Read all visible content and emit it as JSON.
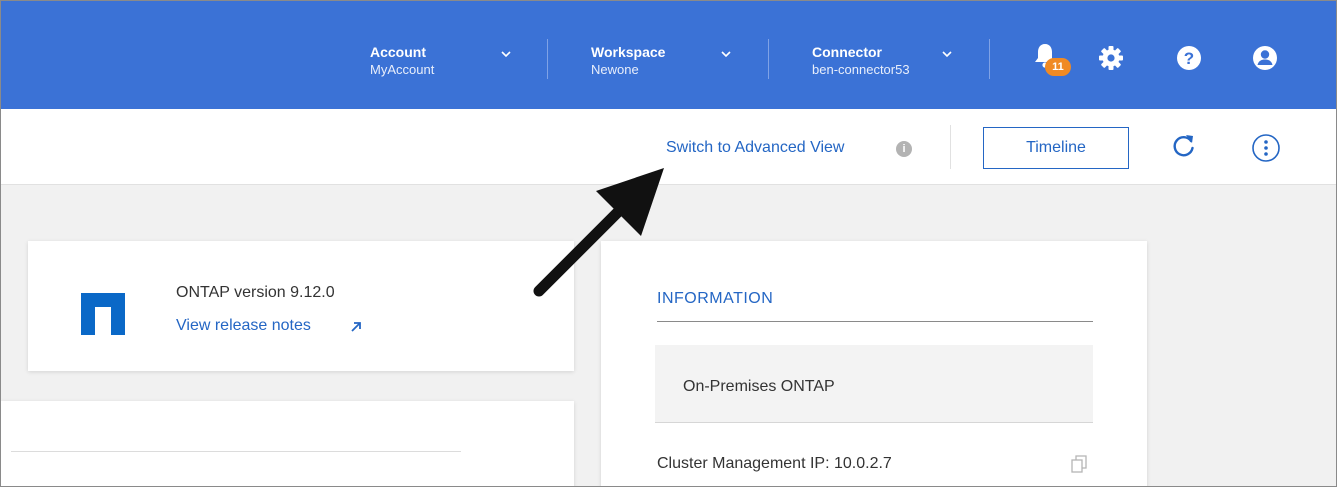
{
  "topbar": {
    "account": {
      "label": "Account",
      "value": "MyAccount"
    },
    "workspace": {
      "label": "Workspace",
      "value": "Newone"
    },
    "connector": {
      "label": "Connector",
      "value": "ben-connector53"
    },
    "notification_count": "11",
    "colors": {
      "bar": "#3b72d6",
      "badge": "#f08a24"
    }
  },
  "subbar": {
    "switch_view": "Switch to Advanced View",
    "info_glyph": "i",
    "timeline": "Timeline"
  },
  "ontap_card": {
    "version": "ONTAP version 9.12.0",
    "release_notes": "View release notes"
  },
  "information": {
    "title": "INFORMATION",
    "environment": "On-Premises ONTAP",
    "cluster_ip_label": "Cluster Management IP:",
    "cluster_ip_value": "10.0.2.7"
  },
  "icons": [
    "chevron-down-icon",
    "bell-icon",
    "gear-icon",
    "help-icon",
    "user-icon",
    "info-icon",
    "refresh-icon",
    "more-options-icon",
    "external-link-icon",
    "copy-icon",
    "netapp-logo-icon",
    "annotation-arrow-icon"
  ]
}
